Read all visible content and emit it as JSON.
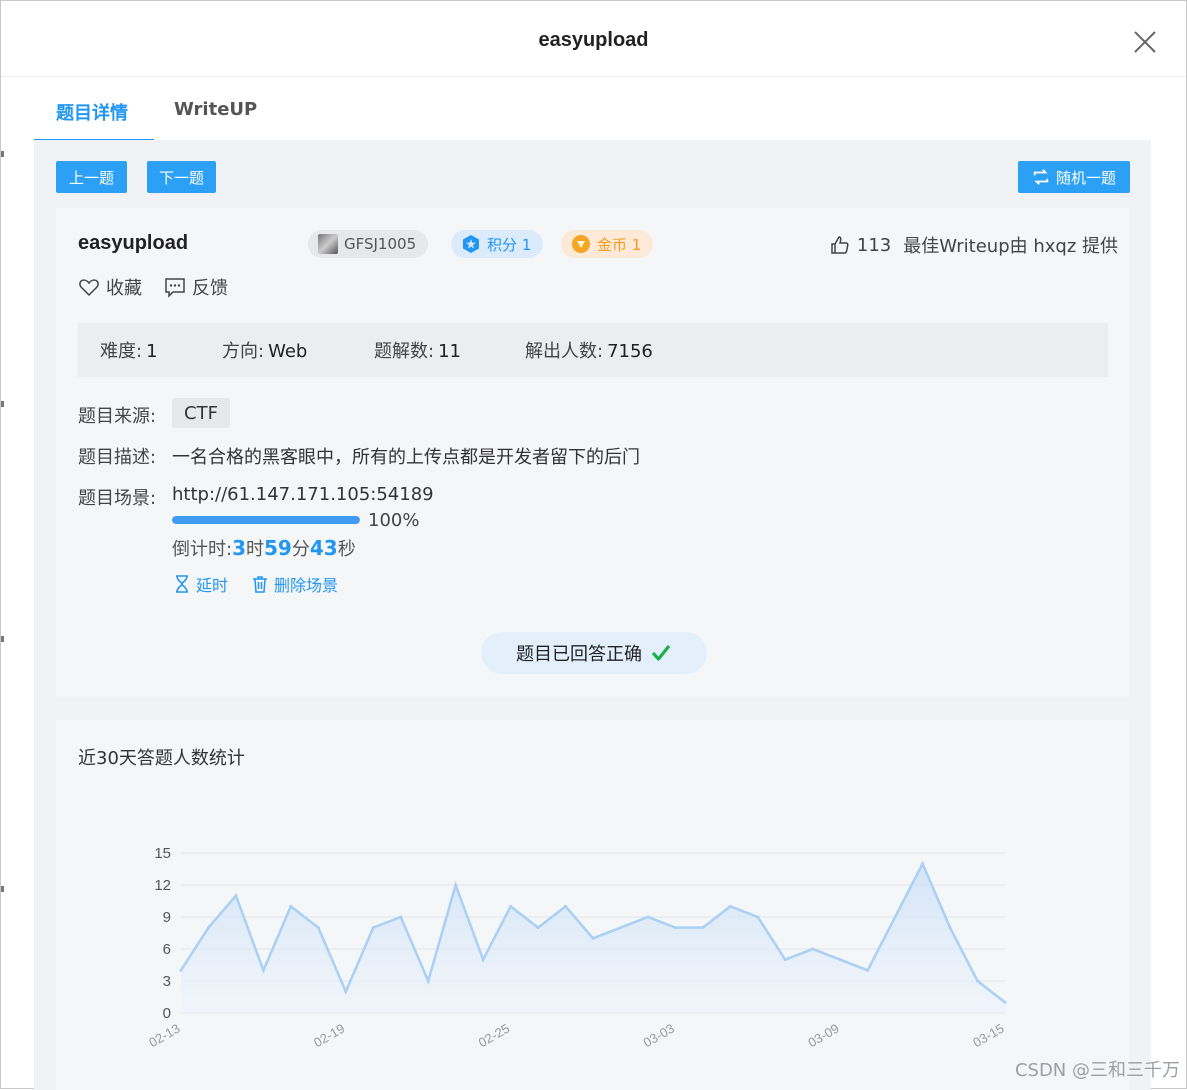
{
  "modal": {
    "title": "easyupload"
  },
  "tabs": [
    {
      "label": "题目详情"
    },
    {
      "label": "WriteUP"
    }
  ],
  "nav": {
    "prev_label": "上一题",
    "next_label": "下一题",
    "random_label": "随机一题"
  },
  "challenge": {
    "name": "easyupload",
    "author_badge": "GFSJ1005",
    "score_badge": "积分 1",
    "coin_badge": "金币 1",
    "likes": "113",
    "best_writeup": "最佳Writeup由 hxqz 提供",
    "favorite_label": "收藏",
    "feedback_label": "反馈",
    "stats": {
      "difficulty_label": "难度:",
      "difficulty_value": "1",
      "direction_label": "方向:",
      "direction_value": "Web",
      "solutions_label": "题解数:",
      "solutions_value": "11",
      "solvers_label": "解出人数:",
      "solvers_value": "7156"
    },
    "source_label": "题目来源:",
    "source_value": "CTF",
    "description_label": "题目描述:",
    "description_value": "一名合格的黑客眼中，所有的上传点都是开发者留下的后门",
    "scene_label": "题目场景:",
    "scene_url": "http://61.147.171.105:54189",
    "progress": 1.0,
    "progress_text": "100%",
    "countdown": {
      "label": "倒计时:",
      "hours": "3",
      "hours_unit": "时",
      "minutes": "59",
      "minutes_unit": "分",
      "seconds": "43",
      "seconds_unit": "秒"
    },
    "extend_label": "延时",
    "delete_label": "删除场景",
    "answered_label": "题目已回答正确"
  },
  "chart_section": {
    "title": "近30天答题人数统计"
  },
  "chart_data": {
    "type": "area",
    "title": "近30天答题人数统计",
    "x": [
      "02-13",
      "02-14",
      "02-15",
      "02-16",
      "02-17",
      "02-18",
      "02-19",
      "02-20",
      "02-21",
      "02-22",
      "02-23",
      "02-24",
      "02-25",
      "02-26",
      "02-27",
      "02-28",
      "03-01",
      "03-02",
      "03-03",
      "03-04",
      "03-05",
      "03-06",
      "03-07",
      "03-08",
      "03-09",
      "03-10",
      "03-11",
      "03-12",
      "03-13",
      "03-14",
      "03-15"
    ],
    "x_tick_labels": [
      "02-13",
      "02-19",
      "02-25",
      "03-03",
      "03-09",
      "03-15"
    ],
    "values": [
      4,
      8,
      11,
      4,
      10,
      8,
      2,
      8,
      9,
      3,
      12,
      5,
      10,
      8,
      10,
      7,
      8,
      9,
      8,
      8,
      10,
      9,
      5,
      6,
      5,
      4,
      9,
      14,
      8,
      3,
      1
    ],
    "yticks": [
      0,
      3,
      6,
      9,
      12,
      15
    ],
    "ylim": [
      0,
      15
    ],
    "grid": true,
    "color": "#a9d0f5"
  },
  "watermark": "CSDN @三和三千万",
  "colors": {
    "accent": "#2196f3",
    "button": "#2ba0f5",
    "success": "#1fae4b"
  }
}
